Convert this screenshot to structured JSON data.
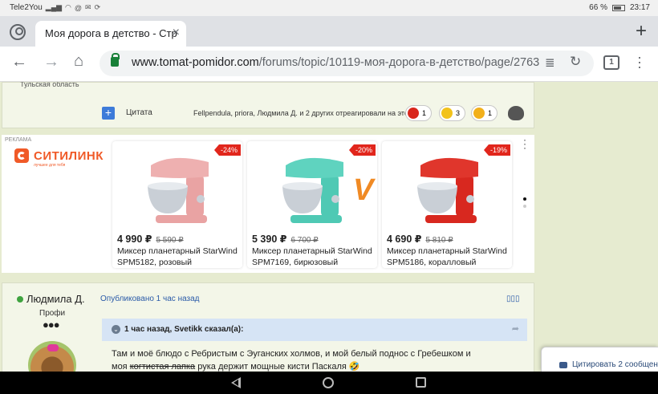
{
  "status_bar": {
    "carrier": "Tele2You",
    "battery": "66 %",
    "time": "23:17"
  },
  "tab": {
    "title": "Моя дорога в детство - Стр",
    "close": "×"
  },
  "toolbar": {
    "url_host": "www.tomat-pomidor.com",
    "url_path": "/forums/topic/10119-моя-дорога-в-детство/page/2763/#coi",
    "tabs_count": "1"
  },
  "previous_post": {
    "region": "Тульская область",
    "quote_label": "Цитата",
    "reactions_text": "Fellpendula, priora, Людмила Д. и 2 других отреагировали на это",
    "reactions": [
      {
        "icon": "apple-icon",
        "color": "#d9261c",
        "count": "1"
      },
      {
        "icon": "laugh-icon",
        "color": "#f2c21b",
        "count": "3"
      },
      {
        "icon": "thumbs-up-icon",
        "color": "#f2b01b",
        "count": "1"
      }
    ]
  },
  "ad": {
    "label": "РЕКЛАМА",
    "brand": "СИТИЛИНК",
    "tagline": "лучшее для тебя",
    "brand_color": "#f05a28",
    "products": [
      {
        "discount": "-24%",
        "price": "4 990 ₽",
        "old_price": "5 590 ₽",
        "name": "Миксер планетарный StarWind SPM5182, розовый",
        "color": "#e9a3a3"
      },
      {
        "discount": "-20%",
        "price": "5 390 ₽",
        "old_price": "6 700 ₽",
        "name": "Миксер планетарный StarWind SPM7169, бирюзовый",
        "color": "#4fc9b4"
      },
      {
        "discount": "-19%",
        "price": "4 690 ₽",
        "old_price": "5 810 ₽",
        "name": "Миксер планетарный StarWind SPM5186, коралловый",
        "color": "#d8281f"
      }
    ]
  },
  "post": {
    "author": "Людмила Д.",
    "role": "Профи",
    "published": "Опубликовано 1 час назад",
    "quote_header": "1 час назад, Svetikk сказал(а):",
    "body_line1": "Там и моё блюдо с Ребристым с Эуганских холмов, и мой белый поднос с Гребешком и",
    "body_line2_pre": "моя ",
    "body_line2_strike": "когтистая лапка",
    "body_line2_post": " рука держит мощные кисти Паскаля 🤣"
  },
  "multiquote": {
    "label": "Цитировать 2 сообщени"
  }
}
